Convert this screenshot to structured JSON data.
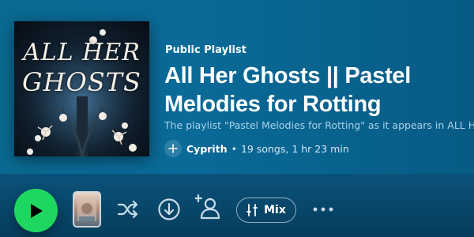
{
  "playlist": {
    "kicker": "Public Playlist",
    "title": "All Her Ghosts || Pastel\nMelodies for Rotting",
    "description": "The playlist \"Pastel Melodies for Rotting\" as it appears in ALL HE",
    "owner": "Cyprith",
    "separator": "•",
    "stats": "19 songs, 1 hr 23 min",
    "cover_text_line1": "ALL HER",
    "cover_text_line2": "GHOSTS"
  },
  "controls": {
    "mix_label": "Mix"
  },
  "icons": {
    "play": "play-icon",
    "shuffle": "shuffle-icon",
    "download": "download-icon",
    "add_user": "add-user-icon",
    "mix": "sliders-icon",
    "more": "more-icon",
    "owner_add": "plus-icon"
  },
  "colors": {
    "accent": "#1ed760",
    "header_bg": "#0a6a92",
    "description": "#a9d2e8"
  }
}
